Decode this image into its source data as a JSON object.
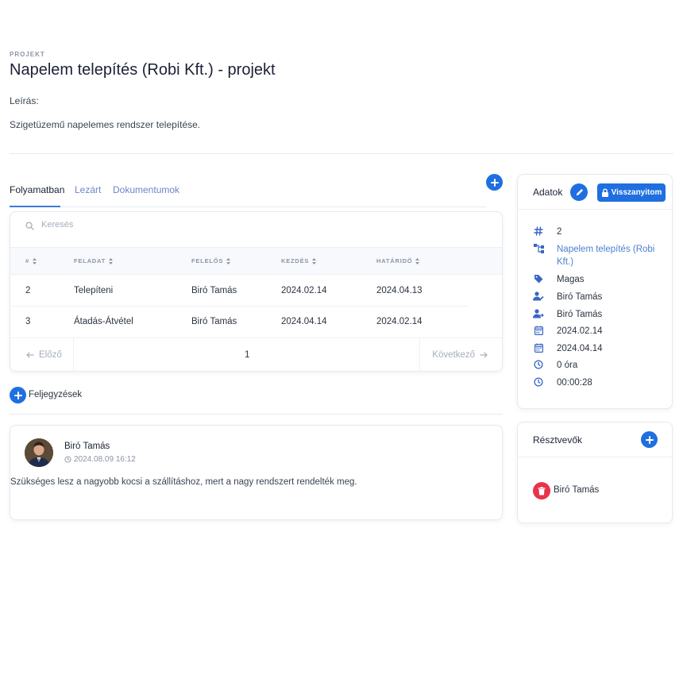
{
  "header": {
    "pretitle": "PROJEKT",
    "title": "Napelem telepítés (Robi Kft.) - projekt",
    "description_label": "Leírás:",
    "description": "Szigetüzemű napelemes rendszer telepítése."
  },
  "tabs": [
    {
      "label": "Folyamatban",
      "active": true
    },
    {
      "label": "Lezárt",
      "active": false
    },
    {
      "label": "Dokumentumok",
      "active": false
    }
  ],
  "search": {
    "placeholder": "Keresés"
  },
  "table": {
    "columns": [
      "#",
      "FELADAT",
      "FELELŐS",
      "KEZDÉS",
      "HATÁRIDŐ"
    ],
    "rows": [
      {
        "id": "2",
        "task": "Telepíteni",
        "owner": "Biró Tamás",
        "start": "2024.02.14",
        "deadline": "2024.04.13"
      },
      {
        "id": "3",
        "task": "Átadás-Átvétel",
        "owner": "Biró Tamás",
        "start": "2024.04.14",
        "deadline": "2024.02.14"
      }
    ]
  },
  "pager": {
    "prev": "Előző",
    "page": "1",
    "next": "Következő"
  },
  "notes": {
    "label": "Feljegyzések",
    "items": [
      {
        "author": "Biró Tamás",
        "time": "2024.08.09 16:12",
        "text": "Szükséges lesz a nagyobb kocsi a szállításhoz, mert a nagy rendszert rendelték meg."
      }
    ]
  },
  "data_card": {
    "title": "Adatok",
    "restore_label": "Visszanyitom",
    "fields": [
      {
        "icon": "hash-icon",
        "value": "2"
      },
      {
        "icon": "project-tree-icon",
        "value": "Napelem telepítés (Robi Kft.)"
      },
      {
        "icon": "tag-icon",
        "value": "Magas"
      },
      {
        "icon": "user-edit-icon",
        "value": "Biró Tamás"
      },
      {
        "icon": "user-arrow-icon",
        "value": "Biró Tamás"
      },
      {
        "icon": "calendar-icon",
        "value": "2024.02.14"
      },
      {
        "icon": "calendar-icon",
        "value": "2024.04.14"
      },
      {
        "icon": "clock-icon",
        "value": "0 óra"
      },
      {
        "icon": "clock-icon",
        "value": "00:00:28"
      }
    ]
  },
  "participants": {
    "title": "Résztvevők",
    "items": [
      {
        "name": "Biró Tamás"
      }
    ]
  },
  "colors": {
    "accent": "#1f6fe0",
    "danger": "#e8334a",
    "link": "#4a7fd0"
  }
}
